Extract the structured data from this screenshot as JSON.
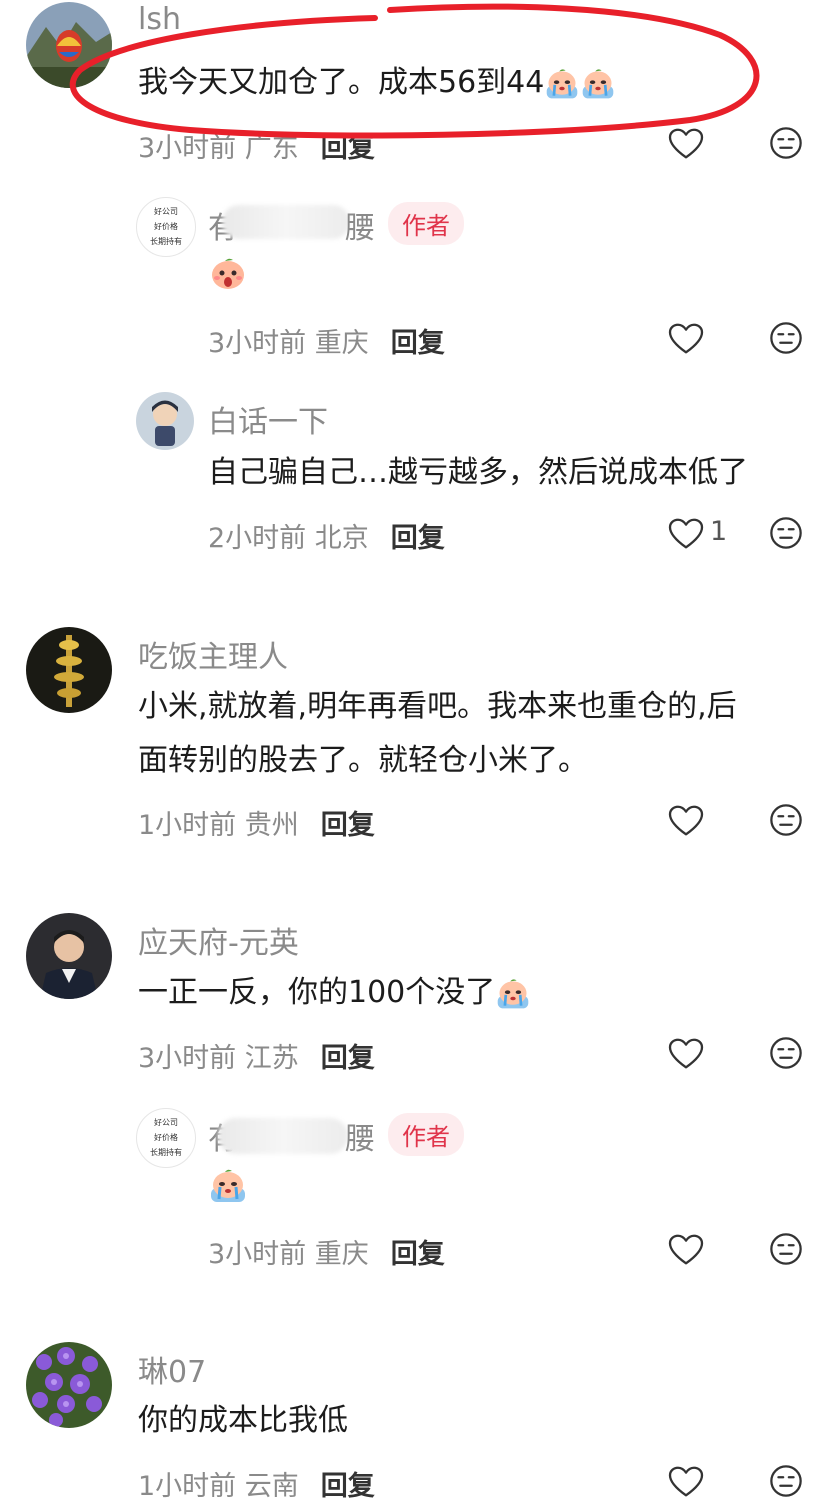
{
  "comments": [
    {
      "name": "lsh",
      "text": "我今天又加仓了。成本56到44",
      "meta": "3小时前 广东",
      "reply": "回复",
      "replies": [
        {
          "name_start": "有",
          "name_end": "腰",
          "badge": "作者",
          "meta": "3小时前 重庆",
          "reply": "回复",
          "avatar_text": [
            "好公司",
            "好价格",
            "长期持有"
          ]
        },
        {
          "name": "白话一下",
          "text": "自己骗自己…越亏越多，然后说成本低了",
          "meta": "2小时前 北京",
          "reply": "回复",
          "likes": "1"
        }
      ]
    },
    {
      "name": "吃饭主理人",
      "text_line1": "小米,就放着,明年再看吧。我本来也重仓的,后",
      "text_line2": "面转别的股去了。就轻仓小米了。",
      "meta": "1小时前 贵州",
      "reply": "回复"
    },
    {
      "name": "应天府-元英",
      "text": "一正一反，你的100个没了",
      "meta": "3小时前 江苏",
      "reply": "回复",
      "replies": [
        {
          "name_start": "有",
          "name_end": "腰",
          "badge": "作者",
          "meta": "3小时前 重庆",
          "reply": "回复",
          "avatar_text": [
            "好公司",
            "好价格",
            "长期持有"
          ]
        }
      ]
    },
    {
      "name": "琳07",
      "text": "你的成本比我低",
      "meta": "1小时前 云南",
      "reply": "回复"
    }
  ],
  "icons": {
    "like": "heart-outline-icon",
    "more": "neutral-face-icon",
    "emoji_cry": "crying-peach-emoji",
    "emoji_shock": "shocked-peach-emoji"
  },
  "colors": {
    "annotation": "#e8202a",
    "author_badge_bg": "#fdecee",
    "author_badge_text": "#e0344a"
  }
}
